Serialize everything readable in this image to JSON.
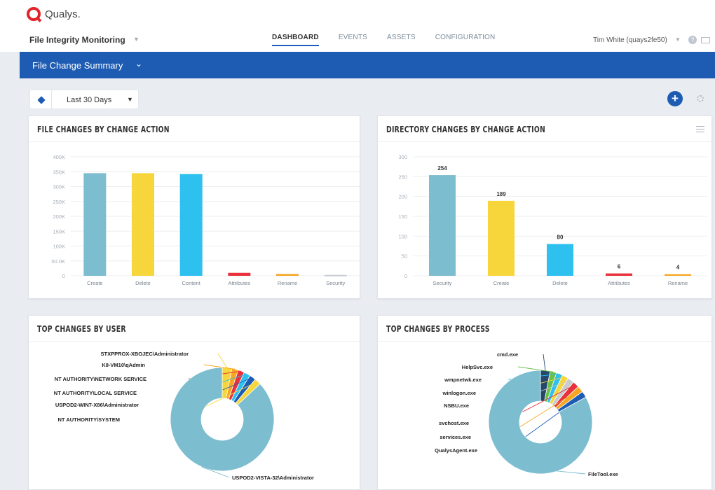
{
  "app": {
    "brand": "Qualys.",
    "module": "File Integrity Monitoring",
    "user": "Tim White (quays2fe50)"
  },
  "nav": {
    "tabs": [
      {
        "label": "DASHBOARD",
        "active": true
      },
      {
        "label": "EVENTS",
        "active": false
      },
      {
        "label": "ASSETS",
        "active": false
      },
      {
        "label": "CONFIGURATION",
        "active": false
      }
    ]
  },
  "dashboard": {
    "title": "File Change Summary",
    "filter": "Last 30 Days"
  },
  "colors": {
    "brand_blue": "#1e5cb3",
    "brand_red": "#e0262b",
    "teal": "#7dbdd0",
    "yellow": "#f6d63b",
    "cyan": "#2ec0ef",
    "red": "#e8313a",
    "orange": "#f5a623",
    "grey": "#c7ccd2"
  },
  "panels": {
    "file_changes": {
      "title": "FILE CHANGES BY CHANGE ACTION"
    },
    "dir_changes": {
      "title": "DIRECTORY CHANGES BY CHANGE ACTION"
    },
    "top_user": {
      "title": "TOP CHANGES BY USER"
    },
    "top_process": {
      "title": "TOP CHANGES BY PROCESS"
    }
  },
  "chart_data": [
    {
      "type": "bar",
      "title": "FILE CHANGES BY CHANGE ACTION",
      "categories": [
        "Create",
        "Delete",
        "Content",
        "Attributes",
        "Rename",
        "Security"
      ],
      "values": [
        345000,
        345000,
        342000,
        10000,
        6000,
        3000
      ],
      "colors": [
        "#7dbdd0",
        "#f6d63b",
        "#2ec0ef",
        "#e8313a",
        "#f5a623",
        "#c7ccd2"
      ],
      "yticks": [
        "0",
        "50.0K",
        "100K",
        "150K",
        "200K",
        "250K",
        "300K",
        "350K",
        "400K"
      ],
      "ylim": [
        0,
        400000
      ]
    },
    {
      "type": "bar",
      "title": "DIRECTORY CHANGES BY CHANGE ACTION",
      "categories": [
        "Security",
        "Create",
        "Delete",
        "Attributes",
        "Rename"
      ],
      "values": [
        254,
        189,
        80,
        6,
        4
      ],
      "data_labels": [
        "254",
        "189",
        "80",
        "6",
        "4"
      ],
      "colors": [
        "#7dbdd0",
        "#f6d63b",
        "#2ec0ef",
        "#e8313a",
        "#f5a623"
      ],
      "yticks": [
        "0",
        "50",
        "100",
        "150",
        "200",
        "250",
        "300"
      ],
      "ylim": [
        0,
        300
      ]
    },
    {
      "type": "pie",
      "title": "TOP CHANGES BY USER",
      "labels": [
        "STXPPROX-XBOJEC\\Administrator",
        "K8-VM10\\qAdmin",
        "NT AUTHORITY\\NETWORK SERVICE",
        "NT AUTHORITY\\LOCAL SERVICE",
        "USPOD2-WIN7-X86\\Administrator",
        "NT AUTHORITY\\SYSTEM",
        "USPOD2-VISTA-32\\Administrator"
      ],
      "values": [
        3,
        2,
        2,
        2,
        2,
        2,
        87
      ],
      "colors": [
        "#f6d63b",
        "#f5a623",
        "#e8313a",
        "#2ec0ef",
        "#1e5cb3",
        "#f6d63b",
        "#7dbdd0"
      ]
    },
    {
      "type": "pie",
      "title": "TOP CHANGES BY PROCESS",
      "labels": [
        "cmd.exe",
        "HelpSvc.exe",
        "wmpnetwk.exe",
        "winlogon.exe",
        "NSBU.exe",
        "svchost.exe",
        "services.exe",
        "QualysAgent.exe",
        "FileTool.exe"
      ],
      "values": [
        3,
        2,
        2,
        2,
        2,
        2,
        2,
        2,
        83
      ],
      "colors": [
        "#24476b",
        "#6cc04a",
        "#2ec0ef",
        "#f6d63b",
        "#c7ccd2",
        "#e8313a",
        "#f5a623",
        "#1e5cb3",
        "#7dbdd0"
      ]
    }
  ]
}
